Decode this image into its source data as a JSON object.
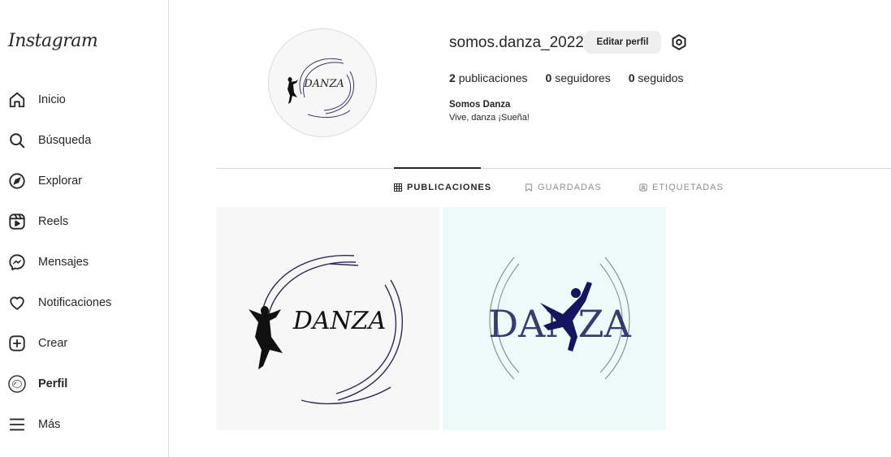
{
  "app": {
    "logo": "Instagram"
  },
  "sidebar": {
    "items": [
      {
        "label": "Inicio",
        "icon": "home-icon"
      },
      {
        "label": "Búsqueda",
        "icon": "search-icon"
      },
      {
        "label": "Explorar",
        "icon": "explore-icon"
      },
      {
        "label": "Reels",
        "icon": "reels-icon"
      },
      {
        "label": "Mensajes",
        "icon": "messenger-icon"
      },
      {
        "label": "Notificaciones",
        "icon": "heart-icon"
      },
      {
        "label": "Crear",
        "icon": "plus-square-icon"
      },
      {
        "label": "Perfil",
        "icon": "profile-avatar",
        "active": true
      },
      {
        "label": "Más",
        "icon": "menu-icon"
      }
    ]
  },
  "profile": {
    "username": "somos.danza_2022",
    "edit_label": "Editar perfil",
    "stats": {
      "posts_count": "2",
      "posts_label": "publicaciones",
      "followers_count": "0",
      "followers_label": "seguidores",
      "following_count": "0",
      "following_label": "seguidos"
    },
    "full_name": "Somos Danza",
    "bio": "Vive, danza ¡Sueña!",
    "avatar_text": "DANZA"
  },
  "tabs": [
    {
      "label": "PUBLICACIONES",
      "icon": "grid-icon",
      "active": true
    },
    {
      "label": "GUARDADAS",
      "icon": "bookmark-icon"
    },
    {
      "label": "ETIQUETADAS",
      "icon": "tag-icon"
    }
  ],
  "posts": [
    {
      "text": "DANZA",
      "background": "#f7f7f7"
    },
    {
      "text": "DANZA",
      "background": "#eefafa"
    }
  ],
  "colors": {
    "text": "#262626",
    "muted": "#8e8e8e",
    "border": "#dbdbdb",
    "button": "#efefef",
    "post_navy": "#1a1a5e"
  }
}
